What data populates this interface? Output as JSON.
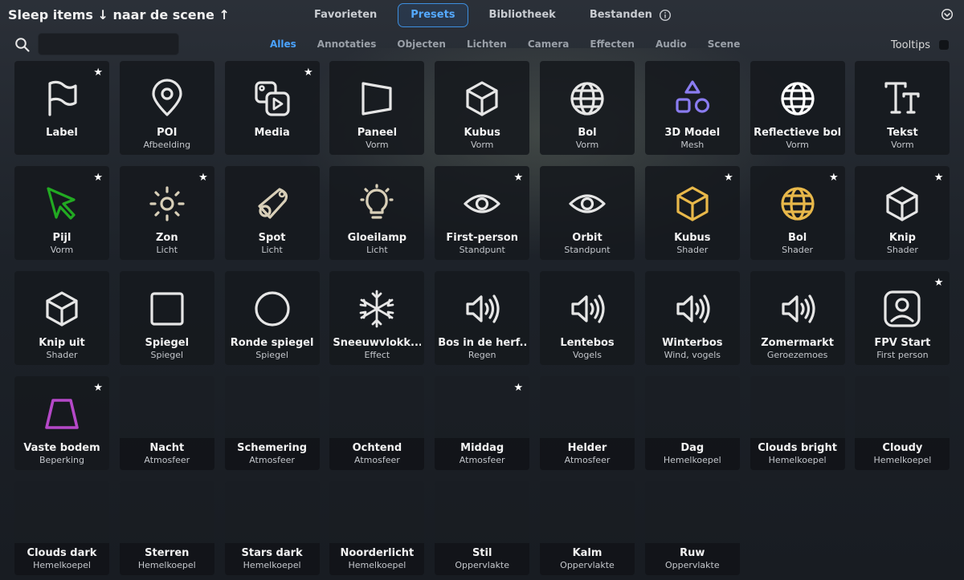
{
  "header": {
    "scene_hint": "Sleep items ↓ naar de scene ↑",
    "tabs": [
      {
        "label": "Favorieten",
        "active": false
      },
      {
        "label": "Presets",
        "active": true
      },
      {
        "label": "Bibliotheek",
        "active": false
      },
      {
        "label": "Bestanden",
        "active": false
      }
    ],
    "info_icon": "info-icon",
    "collapse_icon": "chevron-down-circle-icon"
  },
  "filterbar": {
    "search_value": "",
    "search_icon": "search-icon",
    "filters": [
      {
        "label": "Alles",
        "active": true
      },
      {
        "label": "Annotaties",
        "active": false
      },
      {
        "label": "Objecten",
        "active": false
      },
      {
        "label": "Lichten",
        "active": false
      },
      {
        "label": "Camera",
        "active": false
      },
      {
        "label": "Effecten",
        "active": false
      },
      {
        "label": "Audio",
        "active": false
      },
      {
        "label": "Scene",
        "active": false
      }
    ],
    "tooltips_label": "Tooltips",
    "tooltips_checked": false
  },
  "colors": {
    "accent": "#4aa3ff",
    "icon_default": "#e6e6e6",
    "icon_mesh": "#8a7cf0",
    "icon_shader": "#e8b84a",
    "icon_light": "#d8cfb8",
    "icon_arrow": "#22aa22",
    "icon_floor": "#b548c8"
  },
  "items": [
    {
      "name": "Label",
      "sub": "",
      "icon": "flag-icon",
      "star": true
    },
    {
      "name": "POI",
      "sub": "Afbeelding",
      "icon": "map-pin-icon",
      "star": false
    },
    {
      "name": "Media",
      "sub": "",
      "icon": "media-icon",
      "star": true
    },
    {
      "name": "Paneel",
      "sub": "Vorm",
      "icon": "panel-icon",
      "star": false
    },
    {
      "name": "Kubus",
      "sub": "Vorm",
      "icon": "cube-icon",
      "star": false
    },
    {
      "name": "Bol",
      "sub": "Vorm",
      "icon": "globe-icon",
      "star": false
    },
    {
      "name": "3D Model",
      "sub": "Mesh",
      "icon": "shapes-icon",
      "star": false
    },
    {
      "name": "Reflectieve bol",
      "sub": "Vorm",
      "icon": "globe-white-icon",
      "star": false
    },
    {
      "name": "Tekst",
      "sub": "Vorm",
      "icon": "text-size-icon",
      "star": false
    },
    {
      "name": "Pijl",
      "sub": "Vorm",
      "icon": "cursor-arrow-icon",
      "star": true
    },
    {
      "name": "Zon",
      "sub": "Licht",
      "icon": "sun-icon",
      "star": true
    },
    {
      "name": "Spot",
      "sub": "Licht",
      "icon": "spotlight-icon",
      "star": false
    },
    {
      "name": "Gloeilamp",
      "sub": "Licht",
      "icon": "bulb-icon",
      "star": false
    },
    {
      "name": "First-person",
      "sub": "Standpunt",
      "icon": "eye-icon",
      "star": true
    },
    {
      "name": "Orbit",
      "sub": "Standpunt",
      "icon": "eye-icon",
      "star": false
    },
    {
      "name": "Kubus",
      "sub": "Shader",
      "icon": "cube-gold-icon",
      "star": true
    },
    {
      "name": "Bol",
      "sub": "Shader",
      "icon": "globe-gold-icon",
      "star": true
    },
    {
      "name": "Knip",
      "sub": "Shader",
      "icon": "cube-icon",
      "star": true
    },
    {
      "name": "Knip uit",
      "sub": "Shader",
      "icon": "cube-icon",
      "star": false
    },
    {
      "name": "Spiegel",
      "sub": "Spiegel",
      "icon": "square-icon",
      "star": false
    },
    {
      "name": "Ronde spiegel",
      "sub": "Spiegel",
      "icon": "circle-icon",
      "star": false
    },
    {
      "name": "Sneeuwvlokk...",
      "sub": "Effect",
      "icon": "snowflake-icon",
      "star": false
    },
    {
      "name": "Bos in de herf...",
      "sub": "Regen",
      "icon": "speaker-icon",
      "star": false
    },
    {
      "name": "Lentebos",
      "sub": "Vogels",
      "icon": "speaker-icon",
      "star": false
    },
    {
      "name": "Winterbos",
      "sub": "Wind, vogels",
      "icon": "speaker-icon",
      "star": false
    },
    {
      "name": "Zomermarkt",
      "sub": "Geroezemoes",
      "icon": "speaker-icon",
      "star": false
    },
    {
      "name": "FPV Start",
      "sub": "First person",
      "icon": "user-square-icon",
      "star": true
    },
    {
      "name": "Vaste bodem",
      "sub": "Beperking",
      "icon": "floor-icon",
      "star": true
    },
    {
      "name": "Nacht",
      "sub": "Atmosfeer",
      "icon": "",
      "star": false
    },
    {
      "name": "Schemering",
      "sub": "Atmosfeer",
      "icon": "",
      "star": false
    },
    {
      "name": "Ochtend",
      "sub": "Atmosfeer",
      "icon": "",
      "star": false
    },
    {
      "name": "Middag",
      "sub": "Atmosfeer",
      "icon": "",
      "star": true
    },
    {
      "name": "Helder",
      "sub": "Atmosfeer",
      "icon": "",
      "star": false
    },
    {
      "name": "Dag",
      "sub": "Hemelkoepel",
      "icon": "",
      "star": false
    },
    {
      "name": "Clouds bright",
      "sub": "Hemelkoepel",
      "icon": "",
      "star": false
    },
    {
      "name": "Cloudy",
      "sub": "Hemelkoepel",
      "icon": "",
      "star": false
    },
    {
      "name": "Clouds dark",
      "sub": "Hemelkoepel",
      "icon": "",
      "star": false
    },
    {
      "name": "Sterren",
      "sub": "Hemelkoepel",
      "icon": "",
      "star": false
    },
    {
      "name": "Stars dark",
      "sub": "Hemelkoepel",
      "icon": "",
      "star": false
    },
    {
      "name": "Noorderlicht",
      "sub": "Hemelkoepel",
      "icon": "",
      "star": false
    },
    {
      "name": "Stil",
      "sub": "Oppervlakte",
      "icon": "",
      "star": false
    },
    {
      "name": "Kalm",
      "sub": "Oppervlakte",
      "icon": "",
      "star": false
    },
    {
      "name": "Ruw",
      "sub": "Oppervlakte",
      "icon": "",
      "star": false
    }
  ]
}
